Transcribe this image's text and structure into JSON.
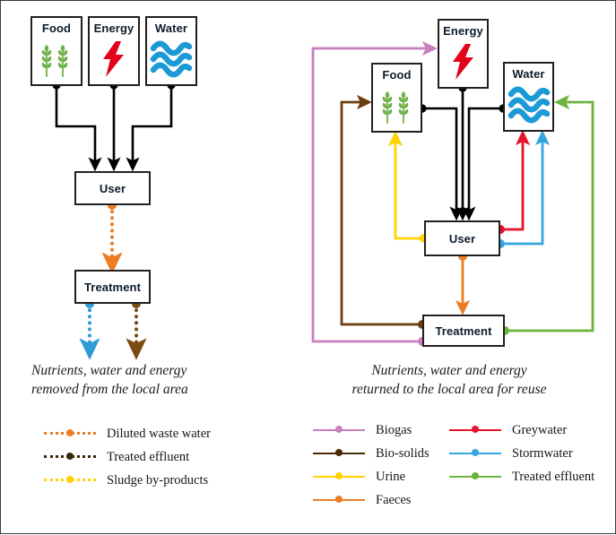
{
  "figure": {
    "left_panel": {
      "title_nodes": [
        "Food",
        "Energy",
        "Water"
      ],
      "nodes": [
        {
          "id": "food",
          "label": "Food",
          "icon": "wheat-icon"
        },
        {
          "id": "energy",
          "label": "Energy",
          "icon": "lightning-bolt-icon"
        },
        {
          "id": "water",
          "label": "Water",
          "icon": "waves-icon"
        },
        {
          "id": "user",
          "label": "User",
          "icon": null
        },
        {
          "id": "treatment",
          "label": "Treatment",
          "icon": null
        }
      ],
      "caption_line1": "Nutrients, water and energy",
      "caption_line2": "removed from the local area",
      "legend": [
        {
          "label": "Diluted waste water",
          "color": "#ED7D23",
          "style": "dotted"
        },
        {
          "label": "Treated effluent",
          "color": "#7A4A12",
          "style": "dotted"
        },
        {
          "label": "Sludge by-products",
          "color": "#FFD200",
          "style": "dotted"
        }
      ],
      "flows": [
        {
          "from": "food",
          "to": "user",
          "color": "#000000",
          "style": "solid",
          "name": "food-to-user"
        },
        {
          "from": "energy",
          "to": "user",
          "color": "#000000",
          "style": "solid",
          "name": "energy-to-user"
        },
        {
          "from": "water",
          "to": "user",
          "color": "#000000",
          "style": "solid",
          "name": "water-to-user"
        },
        {
          "from": "user",
          "to": "treatment",
          "color": "#ED7D23",
          "style": "dotted",
          "name": "diluted-waste-water"
        },
        {
          "from": "treatment",
          "to": "away-left",
          "color": "#2E9BD6",
          "style": "dotted",
          "name": "treated-effluent-out"
        },
        {
          "from": "treatment",
          "to": "away-right",
          "color": "#7A4A12",
          "style": "dotted",
          "name": "sludge-by-products-out"
        }
      ]
    },
    "right_panel": {
      "nodes": [
        {
          "id": "food",
          "label": "Food",
          "icon": "wheat-icon"
        },
        {
          "id": "energy",
          "label": "Energy",
          "icon": "lightning-bolt-icon"
        },
        {
          "id": "water",
          "label": "Water",
          "icon": "waves-icon"
        },
        {
          "id": "user",
          "label": "User",
          "icon": null
        },
        {
          "id": "treatment",
          "label": "Treatment",
          "icon": null
        }
      ],
      "caption_line1": "Nutrients, water and energy",
      "caption_line2": "returned to the local area for reuse",
      "legend_col1": [
        {
          "label": "Biogas",
          "color": "#C77FBE",
          "style": "solid"
        },
        {
          "label": "Bio-solids",
          "color": "#6B3F10",
          "style": "solid"
        },
        {
          "label": "Urine",
          "color": "#FFD200",
          "style": "solid"
        },
        {
          "label": "Faeces",
          "color": "#ED7D23",
          "style": "solid"
        }
      ],
      "legend_col2": [
        {
          "label": "Greywater",
          "color": "#E8122A",
          "style": "solid"
        },
        {
          "label": "Stormwater",
          "color": "#33A6E0",
          "style": "solid"
        },
        {
          "label": "Treated effluent",
          "color": "#6CB33F",
          "style": "solid"
        }
      ],
      "flows": [
        {
          "from": "food",
          "to": "user",
          "color": "#000000",
          "style": "solid",
          "name": "food-to-user"
        },
        {
          "from": "energy",
          "to": "user",
          "color": "#000000",
          "style": "solid",
          "name": "energy-to-user"
        },
        {
          "from": "water",
          "to": "user",
          "color": "#000000",
          "style": "solid",
          "name": "water-to-user"
        },
        {
          "from": "user",
          "to": "treatment",
          "color": "#ED7D23",
          "style": "solid",
          "name": "faeces"
        },
        {
          "from": "user",
          "to": "food",
          "color": "#FFD200",
          "style": "solid",
          "name": "urine"
        },
        {
          "from": "user",
          "to": "water",
          "color": "#E8122A",
          "style": "solid",
          "name": "greywater"
        },
        {
          "from": "user",
          "to": "water",
          "color": "#33A6E0",
          "style": "solid",
          "name": "stormwater"
        },
        {
          "from": "treatment",
          "to": "food",
          "color": "#6B3F10",
          "style": "solid",
          "name": "bio-solids"
        },
        {
          "from": "treatment",
          "to": "energy",
          "color": "#C77FBE",
          "style": "solid",
          "name": "biogas"
        },
        {
          "from": "treatment",
          "to": "water",
          "color": "#6CB33F",
          "style": "solid",
          "name": "treated-effluent"
        }
      ]
    },
    "colors": {
      "black": "#000000",
      "orange": "#ED7D23",
      "brown_dark": "#6B3F10",
      "brown_dotted": "#7A4A12",
      "yellow": "#FFD200",
      "red": "#E8122A",
      "blue": "#33A6E0",
      "blue_dotted": "#2E9BD6",
      "green": "#6CB33F",
      "purple": "#C77FBE",
      "wheat_green": "#6FB14B",
      "water_blue": "#1C9AD6",
      "bolt_red": "#E2001A",
      "box_border": "#231f20"
    }
  }
}
